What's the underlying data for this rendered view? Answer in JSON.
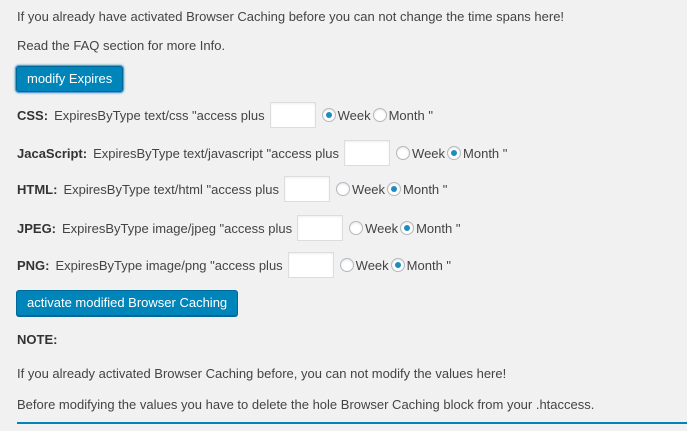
{
  "intro": {
    "line1": "If you already have activated Browser Caching before you can not change the time spans here!",
    "line2": "Read the FAQ section for more Info."
  },
  "modify_button": "modify Expires",
  "rows": [
    {
      "label": "CSS:",
      "text": "ExpiresByType text/css \"access plus",
      "value": "",
      "week": "Week",
      "month": "Month \"",
      "selected": "week"
    },
    {
      "label": "JacaScript:",
      "text": "ExpiresByType text/javascript \"access plus",
      "value": "",
      "week": "Week",
      "month": "Month \"",
      "selected": "month"
    },
    {
      "label": "HTML:",
      "text": "ExpiresByType text/html \"access plus",
      "value": "",
      "week": "Week",
      "month": "Month \"",
      "selected": "month"
    },
    {
      "label": "JPEG:",
      "text": "ExpiresByType image/jpeg \"access plus",
      "value": "",
      "week": "Week",
      "month": "Month \"",
      "selected": "month"
    },
    {
      "label": "PNG:",
      "text": "ExpiresByType image/png \"access plus",
      "value": "",
      "week": "Week",
      "month": "Month \"",
      "selected": "month"
    }
  ],
  "activate_button": "activate modified Browser Caching",
  "note": {
    "heading": "NOTE:",
    "line1": "If you already activated Browser Caching before, you can not modify the values here!",
    "line2": "Before modifying the values you have to delete the hole Browser Caching block from your .htaccess."
  },
  "colors": {
    "accent": "#0085ba",
    "radio_dot": "#1e8cbe",
    "background": "#f1f1f1"
  }
}
